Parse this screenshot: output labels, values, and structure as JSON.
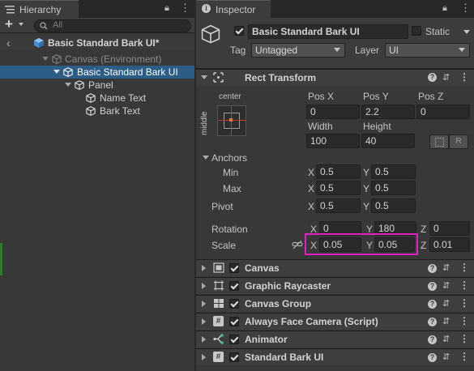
{
  "colors": {
    "selection": "#2c5d87",
    "highlight_box": "#e020c0",
    "panel_bg": "#383838"
  },
  "hierarchy": {
    "tab_title": "Hierarchy",
    "add_label": "+",
    "search_placeholder": "All",
    "scene_title": "Basic Standard Bark UI*",
    "items": [
      {
        "label": "Canvas (Environment)"
      },
      {
        "label": "Basic Standard Bark UI"
      },
      {
        "label": "Panel"
      },
      {
        "label": "Name Text"
      },
      {
        "label": "Bark Text"
      }
    ]
  },
  "inspector": {
    "tab_title": "Inspector",
    "object_name": "Basic Standard Bark UI",
    "static_label": "Static",
    "tag_label": "Tag",
    "tag_value": "Untagged",
    "layer_label": "Layer",
    "layer_value": "UI",
    "rect_transform": {
      "title": "Rect Transform",
      "anchor_h": "center",
      "anchor_v": "middle",
      "pos_x_label": "Pos X",
      "pos_y_label": "Pos Y",
      "pos_z_label": "Pos Z",
      "pos_x": "0",
      "pos_y": "2.2",
      "pos_z": "0",
      "width_label": "Width",
      "height_label": "Height",
      "width": "100",
      "height": "40",
      "r_button": "R",
      "anchors_label": "Anchors",
      "min_label": "Min",
      "max_label": "Max",
      "min_x": "0.5",
      "min_y": "0.5",
      "max_x": "0.5",
      "max_y": "0.5",
      "pivot_label": "Pivot",
      "pivot_x": "0.5",
      "pivot_y": "0.5",
      "rotation_label": "Rotation",
      "rot_x": "0",
      "rot_y": "180",
      "rot_z": "0",
      "scale_label": "Scale",
      "scale_x": "0.05",
      "scale_y": "0.05",
      "scale_z": "0.01",
      "x": "X",
      "y": "Y",
      "z": "Z"
    },
    "components": [
      {
        "name": "Canvas",
        "icon": "canvas-icon"
      },
      {
        "name": "Graphic Raycaster",
        "icon": "raycaster-icon"
      },
      {
        "name": "Canvas Group",
        "icon": "canvas-group-icon"
      },
      {
        "name": "Always Face Camera (Script)",
        "icon": "script-icon"
      },
      {
        "name": "Animator",
        "icon": "animator-icon"
      },
      {
        "name": "Standard Bark UI",
        "icon": "script-icon"
      }
    ]
  }
}
